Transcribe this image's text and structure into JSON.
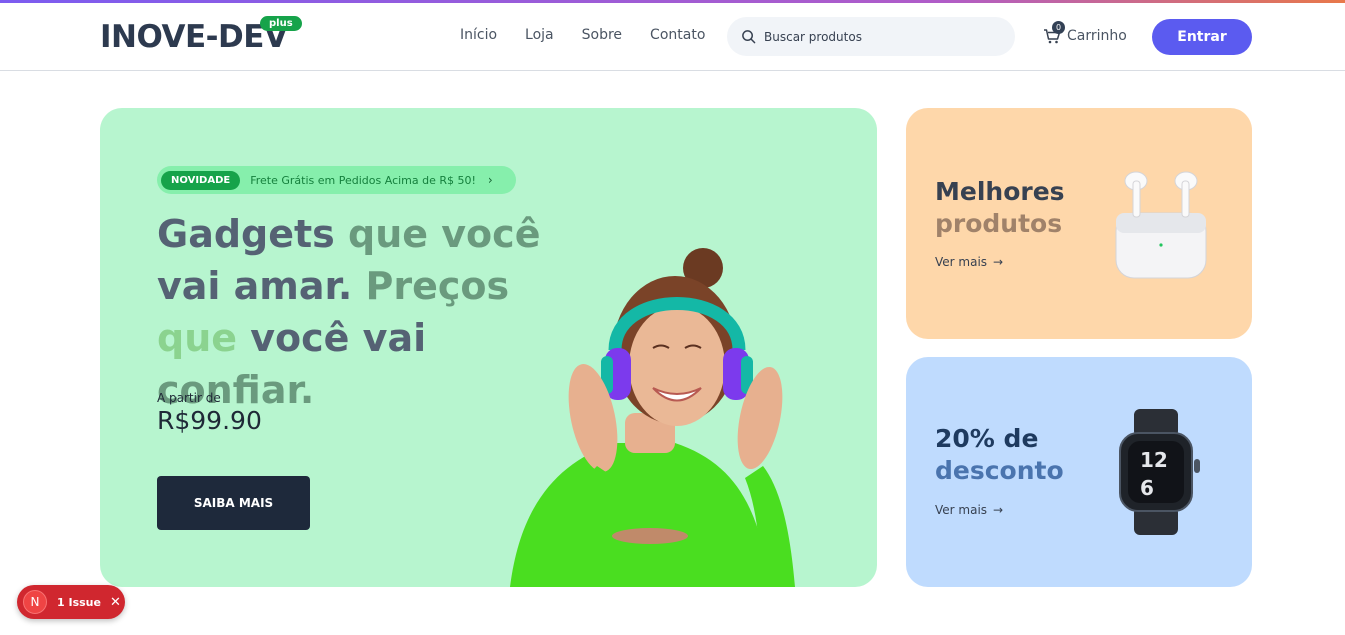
{
  "header": {
    "logo": "INOVE-DEV",
    "logo_badge": "plus",
    "nav": [
      "Início",
      "Loja",
      "Sobre",
      "Contato"
    ],
    "search_placeholder": "Buscar produtos",
    "cart_label": "Carrinho",
    "cart_count": "0",
    "login_label": "Entrar",
    "accent_color": "#5b5bf0"
  },
  "hero": {
    "promo_tag": "NOVIDADE",
    "promo_text": "Frete Grátis em Pedidos Acima de R$ 50!",
    "headline_parts": [
      "Gadgets ",
      "que você",
      " vai amar. ",
      "Preços",
      " que ",
      "você vai ",
      "confiar."
    ],
    "price_label": "A partir de",
    "price": "R$99.90",
    "cta_label": "SAIBA MAIS",
    "background_color": "#b7f5cf"
  },
  "cards": [
    {
      "title_line1": "Melhores",
      "title_line2": "produtos",
      "link": "Ver mais",
      "background_color": "#fed7aa",
      "image": "airpods-icon"
    },
    {
      "title_line1": "20% de",
      "title_line2": "desconto",
      "link": "Ver mais",
      "background_color": "#bfdbfe",
      "image": "smartwatch-icon"
    }
  ],
  "issue_badge": {
    "initial": "N",
    "text": "1 Issue"
  }
}
